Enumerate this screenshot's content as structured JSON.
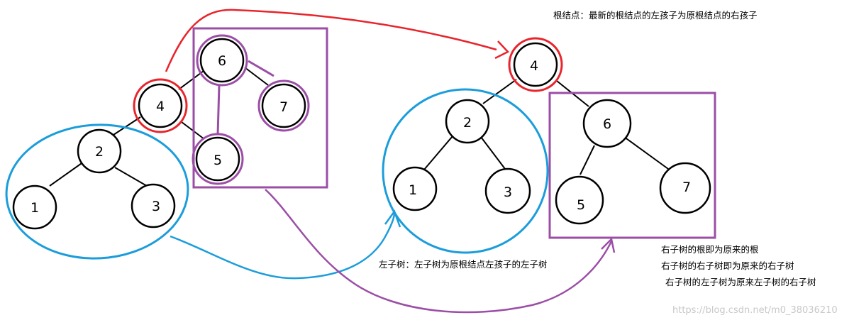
{
  "diagram": {
    "before_tree": {
      "nodes": [
        "6",
        "4",
        "7",
        "5",
        "2",
        "1",
        "3"
      ]
    },
    "after_tree": {
      "nodes": [
        "4",
        "2",
        "1",
        "3",
        "6",
        "5",
        "7"
      ]
    }
  },
  "notes": {
    "root_note": "根结点：最新的根结点的左孩子为原根结点的右孩子",
    "left_subtree_note": "左子树：左子树为原根结点左孩子的左子树",
    "right_subtree_notes": [
      "右子树的根即为原来的根",
      "右子树的右子树即为原来的右子树",
      "右子树的左子树为原来左子树的右子树"
    ]
  },
  "watermark": "https://blog.csdn.net/m0_38036210",
  "colors": {
    "red": "#e8242c",
    "blue": "#1b9ddb",
    "purple": "#9b4ea6",
    "black": "#000000"
  }
}
